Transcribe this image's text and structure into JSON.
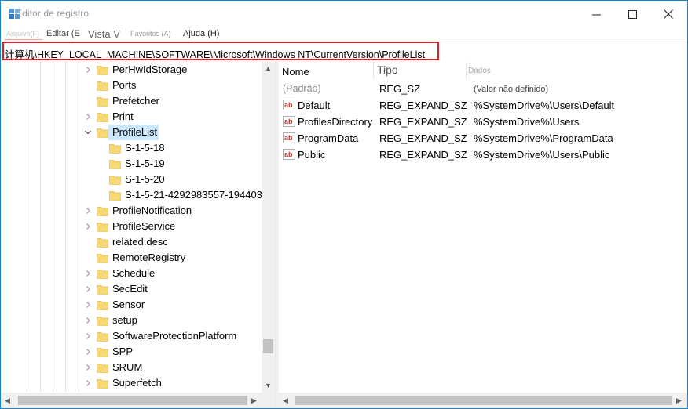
{
  "window": {
    "title": "Editor de registro",
    "close_glyph": "✕",
    "min_glyph": "—",
    "max_glyph": "☐"
  },
  "menu": {
    "file": "Arquivo(F)",
    "edit": "Editar (E",
    "view": "Vista V",
    "favorites": "Favoritos (A)",
    "help": "Ajuda (H)"
  },
  "address": {
    "path": "计算机\\HKEY_LOCAL_MACHINE\\SOFTWARE\\Microsoft\\Windows NT\\CurrentVersion\\ProfileList"
  },
  "tree": {
    "items": [
      {
        "label": "PerHwIdStorage",
        "level": 0,
        "expander": "collapsed"
      },
      {
        "label": "Ports",
        "level": 0,
        "expander": "none"
      },
      {
        "label": "Prefetcher",
        "level": 0,
        "expander": "none"
      },
      {
        "label": "Print",
        "level": 0,
        "expander": "collapsed"
      },
      {
        "label": "ProfileList",
        "level": 0,
        "expander": "expanded",
        "selected": true
      },
      {
        "label": "S-1-5-18",
        "level": 1,
        "expander": "none"
      },
      {
        "label": "S-1-5-19",
        "level": 1,
        "expander": "none"
      },
      {
        "label": "S-1-5-20",
        "level": 1,
        "expander": "none"
      },
      {
        "label": "S-1-5-21-4292983557-194403",
        "level": 1,
        "expander": "none"
      },
      {
        "label": "ProfileNotification",
        "level": 0,
        "expander": "collapsed"
      },
      {
        "label": "ProfileService",
        "level": 0,
        "expander": "collapsed"
      },
      {
        "label": "related.desc",
        "level": 0,
        "expander": "none"
      },
      {
        "label": "RemoteRegistry",
        "level": 0,
        "expander": "none"
      },
      {
        "label": "Schedule",
        "level": 0,
        "expander": "collapsed"
      },
      {
        "label": "SecEdit",
        "level": 0,
        "expander": "collapsed"
      },
      {
        "label": "Sensor",
        "level": 0,
        "expander": "collapsed"
      },
      {
        "label": "setup",
        "level": 0,
        "expander": "collapsed"
      },
      {
        "label": "SoftwareProtectionPlatform",
        "level": 0,
        "expander": "collapsed"
      },
      {
        "label": "SPP",
        "level": 0,
        "expander": "collapsed"
      },
      {
        "label": "SRUM",
        "level": 0,
        "expander": "collapsed"
      },
      {
        "label": "Superfetch",
        "level": 0,
        "expander": "collapsed"
      }
    ]
  },
  "values": {
    "headers": {
      "name": "Nome",
      "type": "Tipo",
      "data": "Dados"
    },
    "rows": [
      {
        "name": "(Padrão)",
        "type": "REG_SZ",
        "data": "(Valor não definido)",
        "default": true
      },
      {
        "name": "Default",
        "type": "REG_EXPAND_SZ",
        "data": "%SystemDrive%\\Users\\Default"
      },
      {
        "name": "ProfilesDirectory",
        "type": "REG_EXPAND_SZ",
        "data": "%SystemDrive%\\Users"
      },
      {
        "name": "ProgramData",
        "type": "REG_EXPAND_SZ",
        "data": "%SystemDrive%\\ProgramData"
      },
      {
        "name": "Public",
        "type": "REG_EXPAND_SZ",
        "data": "%SystemDrive%\\Users\\Public"
      }
    ]
  },
  "colors": {
    "highlight_border": "#d9222a",
    "selection": "#cce8ff",
    "folder": "#f8d775",
    "folder_dark": "#e8b84a",
    "window_border": "#1883d7"
  }
}
